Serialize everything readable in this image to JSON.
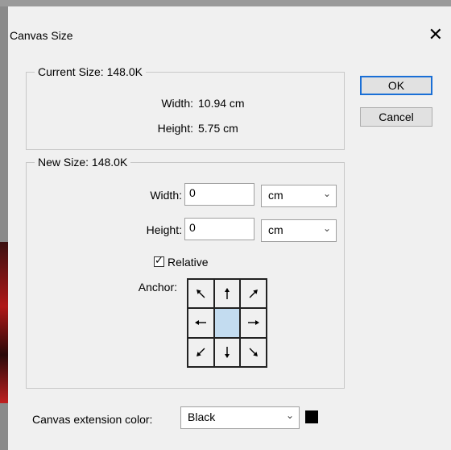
{
  "dialog": {
    "title": "Canvas Size",
    "close_glyph": "✕"
  },
  "current_size": {
    "legend": "Current Size: 148.0K",
    "width_label": "Width:",
    "width_value": "10.94 cm",
    "height_label": "Height:",
    "height_value": "5.75 cm"
  },
  "new_size": {
    "legend": "New Size: 148.0K",
    "width_label": "Width:",
    "width_value": "0",
    "width_unit": "cm",
    "height_label": "Height:",
    "height_value": "0",
    "height_unit": "cm",
    "relative_label": "Relative",
    "relative_checked": true,
    "anchor_label": "Anchor:"
  },
  "anchor": {
    "active": "center",
    "cells": [
      {
        "id": "top-left",
        "icon": "arrow-up-left-icon"
      },
      {
        "id": "top",
        "icon": "arrow-up-icon"
      },
      {
        "id": "top-right",
        "icon": "arrow-up-right-icon"
      },
      {
        "id": "left",
        "icon": "arrow-left-icon"
      },
      {
        "id": "center",
        "icon": ""
      },
      {
        "id": "right",
        "icon": "arrow-right-icon"
      },
      {
        "id": "bottom-left",
        "icon": "arrow-down-left-icon"
      },
      {
        "id": "bottom",
        "icon": "arrow-down-icon"
      },
      {
        "id": "bottom-right",
        "icon": "arrow-down-right-icon"
      }
    ]
  },
  "extension": {
    "label": "Canvas extension color:",
    "value": "Black",
    "swatch_color": "#000000"
  },
  "buttons": {
    "ok": "OK",
    "cancel": "Cancel"
  },
  "colors": {
    "accent": "#1a6fd6",
    "anchor_active": "#c3dcf0"
  }
}
